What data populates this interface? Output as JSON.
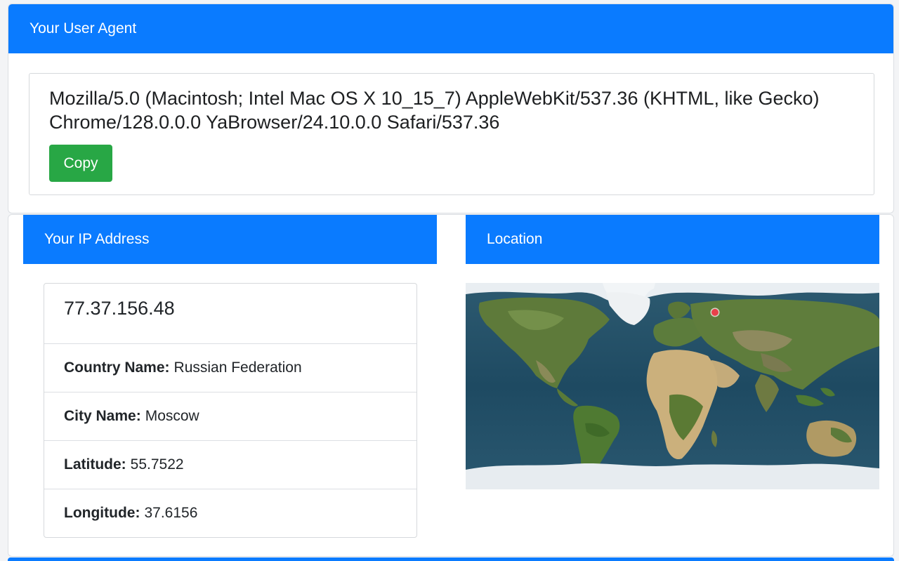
{
  "user_agent": {
    "header": "Your User Agent",
    "value": "Mozilla/5.0 (Macintosh; Intel Mac OS X 10_15_7) AppleWebKit/537.36 (KHTML, like Gecko) Chrome/128.0.0.0 YaBrowser/24.10.0.0 Safari/537.36",
    "copy_label": "Copy"
  },
  "ip": {
    "header": "Your IP Address",
    "address": "77.37.156.48",
    "rows": [
      {
        "label": "Country Name:",
        "value": "Russian Federation"
      },
      {
        "label": "City Name:",
        "value": "Moscow"
      },
      {
        "label": "Latitude:",
        "value": "55.7522"
      },
      {
        "label": "Longitude:",
        "value": "37.6156"
      }
    ]
  },
  "location": {
    "header": "Location",
    "marker_lat": 55.7522,
    "marker_lon": 37.6156,
    "marker_color": "#e8404a"
  },
  "colors": {
    "accent": "#0a7bff",
    "success": "#28a745"
  }
}
